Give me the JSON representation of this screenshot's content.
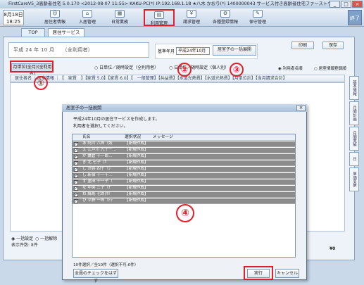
{
  "window": {
    "title": "FirstCareV5_3高齢者住宅 5.0.170 <2012-08-07 11:55> KAKU-PC(*) IP:192.168.1.18 ★八木 かおり(*) 1400000043 サービス付き高齢者住宅ファーストケア",
    "min": "_",
    "max": "□",
    "close": "×"
  },
  "clock": {
    "date": "8月18日",
    "time": "18:25"
  },
  "toolbar": {
    "items": [
      {
        "label": "居住者情報"
      },
      {
        "label": "入居管理"
      },
      {
        "label": "日常業務"
      },
      {
        "label": "利用管理"
      },
      {
        "label": "請求管理"
      },
      {
        "label": "各種登録情報"
      },
      {
        "label": "保守管理"
      }
    ],
    "help": "終了"
  },
  "tabs": [
    {
      "label": "TOP"
    },
    {
      "label": "居住サービス"
    }
  ],
  "header": {
    "date_text": "平成 24 年 10 月　　（全利用者）",
    "print": "印刷",
    "save": "保存"
  },
  "filter": {
    "month_label": "基準年月",
    "month_value": "平成24年10月",
    "bulk_button": "居室子の一括展開"
  },
  "actions": {
    "monthly_button": "月単位(全月)(全利用者)",
    "radio1": "日単位／随時設定（全利用者）",
    "radio2": "日単位／随時設定（個人別）",
    "radio3": "利用者名順",
    "radio4": "居室情報登録順"
  },
  "grid_header": "居住者名 ｜居室情報 ｜【　家賃　】【家賃 5.0】【家賃 6.0】【　一般管理】【共益費】【水道光熱費】【水道光熱費】【月単位計】【当月請求合計】",
  "right_tabs": [
    "基本情報",
    "月間計画",
    "月間実績",
    "日",
    "単価変更"
  ],
  "bottom": {
    "r1": "一括設定",
    "r2": "一括解除",
    "count_label": "表示件数: 8件",
    "total": "¥0"
  },
  "annotations": {
    "n1": "①",
    "n2": "②",
    "n3": "③",
    "n4": "④"
  },
  "dialog": {
    "title": "居室子の一括展開",
    "close": "×",
    "line1": "平成24年10月の居住サービスを作成します。",
    "line2": "利用者を選択してください。",
    "columns": {
      "name": "氏名",
      "status": "選択状況",
      "message": "メッセージ"
    },
    "rows": [
      {
        "name": "あ 阿川 八郎（奴",
        "status": "【新規作成】"
      },
      {
        "name": "え 江戸川 九十一…",
        "status": "【新規作成】"
      },
      {
        "name": "か 鎌倉 十一郎…",
        "status": "【新規作成】"
      },
      {
        "name": "き 北 七子（ｷ",
        "status": "【新規作成】"
      },
      {
        "name": "し 渋谷 四十（ｼ",
        "status": "【新規作成】"
      },
      {
        "name": "し 新宿 十一十…",
        "status": "【新規作成】"
      },
      {
        "name": "す 墨田 十一子（",
        "status": "【新規作成】"
      },
      {
        "name": "な 中央 三子（ﾅ",
        "status": "【新規作成】"
      },
      {
        "name": "ね 練馬 七郎(ﾈﾘ",
        "status": "【新規作成】"
      },
      {
        "name": "ひ 平野 一郎（ﾋﾗ",
        "status": "【新規作成】"
      }
    ],
    "count": "10件選択／全10件（選択不可:0件）",
    "clear_all": "全員のチェックをはずす",
    "execute": "実行",
    "cancel": "キャンセル"
  }
}
